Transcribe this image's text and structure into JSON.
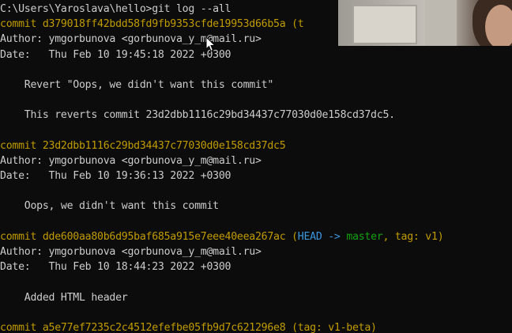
{
  "terminal": {
    "lines": [
      [
        {
          "t": "C:\\Users\\Yaroslava\\hello>git log --all",
          "c": ""
        }
      ],
      [
        {
          "t": "commit d379018ff42bdd58fd9fb9353cfde19953d66b5a (t",
          "c": "yellow"
        }
      ],
      [
        {
          "t": "Author: ymgorbunova <gorbunova_y_m@mail.ru>",
          "c": ""
        }
      ],
      [
        {
          "t": "Date:   Thu Feb 10 19:45:18 2022 +0300",
          "c": ""
        }
      ],
      [
        {
          "t": "",
          "c": ""
        }
      ],
      [
        {
          "t": "    Revert \"Oops, we didn't want this commit\"",
          "c": ""
        }
      ],
      [
        {
          "t": "",
          "c": ""
        }
      ],
      [
        {
          "t": "    This reverts commit 23d2dbb1116c29bd34437c77030d0e158cd37dc5.",
          "c": ""
        }
      ],
      [
        {
          "t": "",
          "c": ""
        }
      ],
      [
        {
          "t": "commit 23d2dbb1116c29bd34437c77030d0e158cd37dc5",
          "c": "yellow"
        }
      ],
      [
        {
          "t": "Author: ymgorbunova <gorbunova_y_m@mail.ru>",
          "c": ""
        }
      ],
      [
        {
          "t": "Date:   Thu Feb 10 19:36:13 2022 +0300",
          "c": ""
        }
      ],
      [
        {
          "t": "",
          "c": ""
        }
      ],
      [
        {
          "t": "    Oops, we didn't want this commit",
          "c": ""
        }
      ],
      [
        {
          "t": "",
          "c": ""
        }
      ],
      [
        {
          "t": "commit dde600aa80b6d95baf685a915e7eee40eea267ac (",
          "c": "yellow"
        },
        {
          "t": "HEAD -> ",
          "c": "cyan"
        },
        {
          "t": "master",
          "c": "green"
        },
        {
          "t": ", ",
          "c": "yellow"
        },
        {
          "t": "tag: v1",
          "c": "yellow"
        },
        {
          "t": ")",
          "c": "yellow"
        }
      ],
      [
        {
          "t": "Author: ymgorbunova <gorbunova_y_m@mail.ru>",
          "c": ""
        }
      ],
      [
        {
          "t": "Date:   Thu Feb 10 18:44:23 2022 +0300",
          "c": ""
        }
      ],
      [
        {
          "t": "",
          "c": ""
        }
      ],
      [
        {
          "t": "    Added HTML header",
          "c": ""
        }
      ],
      [
        {
          "t": "",
          "c": ""
        }
      ],
      [
        {
          "t": "commit a5e77ef7235c2c4512efefbe05fb9d7c621296e8 (tag: v1-beta)",
          "c": "yellow"
        }
      ]
    ]
  },
  "colors": {
    "background": "#0c0c0c",
    "text": "#cccccc",
    "commit_hash": "#c19c00",
    "head_ref": "#3a96dd",
    "branch": "#13a10e"
  },
  "icons": {
    "pointer": "mouse-pointer-icon"
  }
}
